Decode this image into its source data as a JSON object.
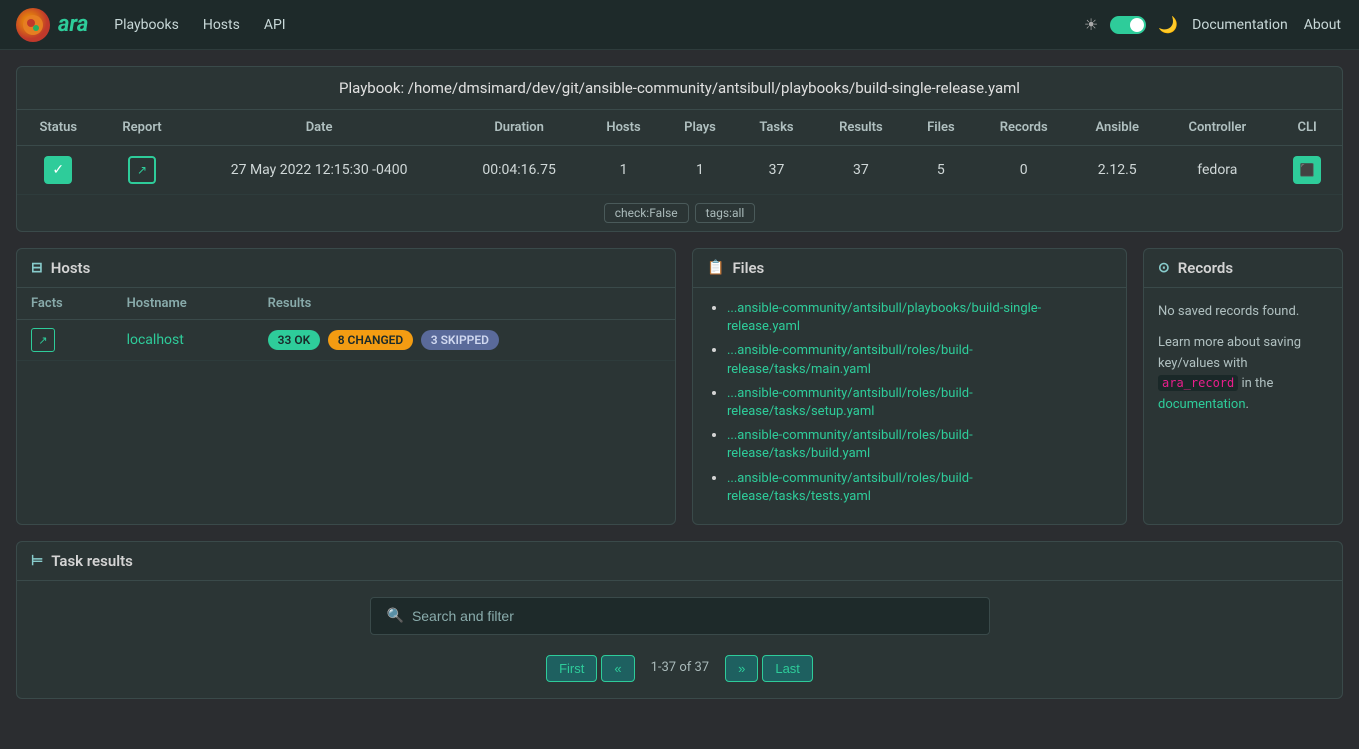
{
  "brand": {
    "name": "ara",
    "logo_alt": "ara logo"
  },
  "nav": {
    "links": [
      "Playbooks",
      "Hosts",
      "API"
    ],
    "right": [
      "Documentation",
      "About"
    ]
  },
  "playbook": {
    "title": "Playbook: /home/dmsimard/dev/git/ansible-community/antsibull/playbooks/build-single-release.yaml",
    "columns": [
      "Status",
      "Report",
      "Date",
      "Duration",
      "Hosts",
      "Plays",
      "Tasks",
      "Results",
      "Files",
      "Records",
      "Ansible",
      "Controller",
      "CLI"
    ],
    "row": {
      "status": "✓",
      "date": "27 May 2022 12:15:30 -0400",
      "duration": "00:04:16.75",
      "hosts": "1",
      "plays": "1",
      "tasks": "37",
      "results": "37",
      "files": "5",
      "records": "0",
      "ansible": "2.12.5",
      "controller": "fedora"
    },
    "tags": [
      "check:False",
      "tags:all"
    ]
  },
  "hosts_panel": {
    "title": "Hosts",
    "columns": [
      "Facts",
      "Hostname",
      "Results"
    ],
    "row": {
      "hostname": "localhost",
      "badge_ok": "33 OK",
      "badge_changed": "8 CHANGED",
      "badge_skipped": "3 SKIPPED"
    }
  },
  "files_panel": {
    "title": "Files",
    "files": [
      "...ansible-community/antsibull/playbooks/build-single-release.yaml",
      "...ansible-community/antsibull/roles/build-release/tasks/main.yaml",
      "...ansible-community/antsibull/roles/build-release/tasks/setup.yaml",
      "...ansible-community/antsibull/roles/build-release/tasks/build.yaml",
      "...ansible-community/antsibull/roles/build-release/tasks/tests.yaml"
    ]
  },
  "records_panel": {
    "title": "Records",
    "no_records_text": "No saved records found.",
    "learn_text": "Learn more about saving key/values with",
    "code": "ara_record",
    "in_text": "in the",
    "doc_link": "documentation",
    "period": "."
  },
  "task_results": {
    "title": "Task results",
    "search_placeholder": "Search and filter",
    "pagination": {
      "first": "First",
      "prev": "«",
      "info": "1-37 of 37",
      "next": "»",
      "last": "Last"
    }
  }
}
